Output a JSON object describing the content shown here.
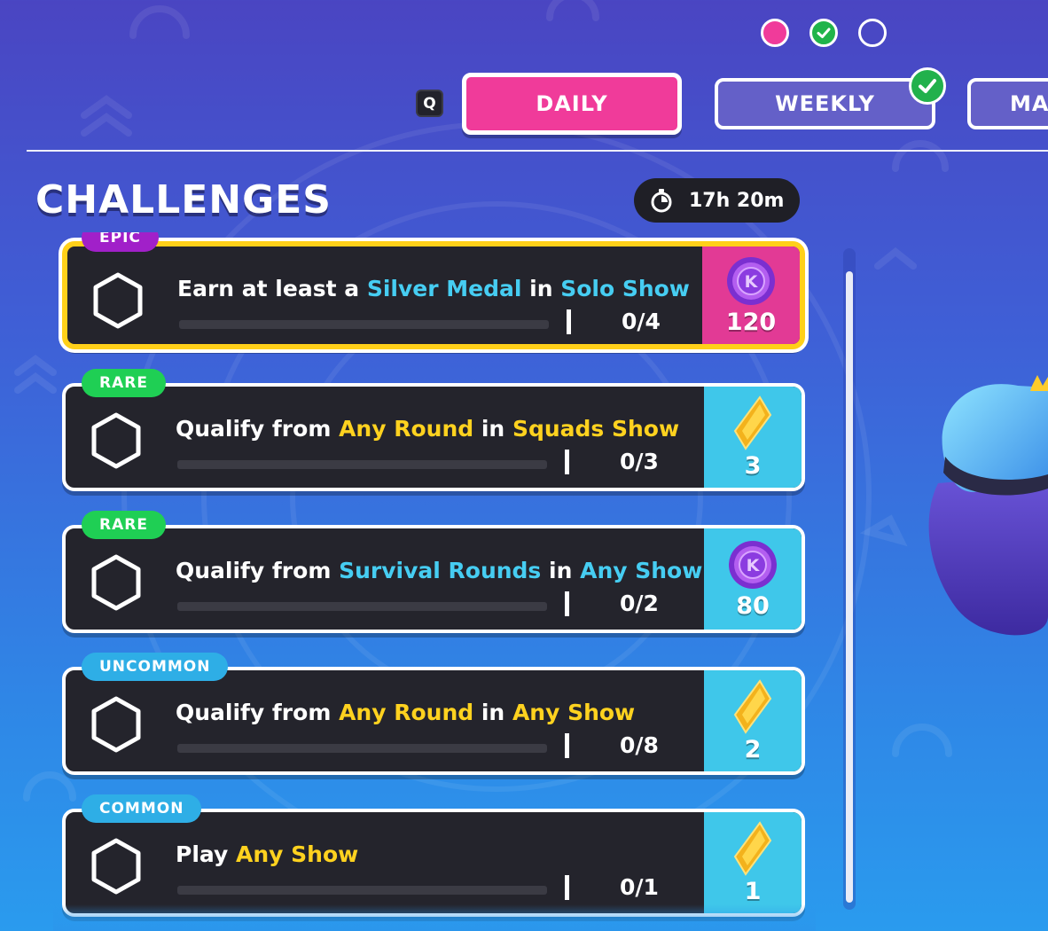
{
  "pager": {
    "pages": [
      {
        "state": "active"
      },
      {
        "state": "completed"
      },
      {
        "state": "empty"
      }
    ]
  },
  "tabs": {
    "key_hint": "Q",
    "items": [
      {
        "label": "DAILY",
        "selected": true
      },
      {
        "label": "WEEKLY",
        "completed": true
      },
      {
        "label": "MA"
      }
    ]
  },
  "header": {
    "title": "CHALLENGES",
    "timer": "17h 20m"
  },
  "challenges": [
    {
      "rarity": "EPIC",
      "parts": [
        {
          "text": "Earn at least a "
        },
        {
          "text": "Silver Medal",
          "hl": "cyan"
        },
        {
          "text": " in "
        },
        {
          "text": "Solo Show",
          "hl": "cyan"
        }
      ],
      "progress": "0/4",
      "progress_fraction": 0,
      "reward": "120",
      "reward_type": "kudos",
      "reward_bg": "#e23a95"
    },
    {
      "rarity": "RARE",
      "parts": [
        {
          "text": "Qualify from "
        },
        {
          "text": "Any Round",
          "hl": "yellow"
        },
        {
          "text": " in "
        },
        {
          "text": "Squads Show",
          "hl": "yellow"
        }
      ],
      "progress": "0/3",
      "progress_fraction": 0,
      "reward": "3",
      "reward_type": "gem",
      "reward_bg": "#3fc7ea"
    },
    {
      "rarity": "RARE",
      "parts": [
        {
          "text": "Qualify from "
        },
        {
          "text": "Survival Rounds",
          "hl": "cyan"
        },
        {
          "text": " in "
        },
        {
          "text": "Any Show",
          "hl": "cyan"
        }
      ],
      "progress": "0/2",
      "progress_fraction": 0,
      "reward": "80",
      "reward_type": "kudos",
      "reward_bg": "#3fc7ea"
    },
    {
      "rarity": "UNCOMMON",
      "parts": [
        {
          "text": "Qualify from "
        },
        {
          "text": "Any Round",
          "hl": "yellow"
        },
        {
          "text": " in "
        },
        {
          "text": "Any Show",
          "hl": "yellow"
        }
      ],
      "progress": "0/8",
      "progress_fraction": 0,
      "reward": "2",
      "reward_type": "gem",
      "reward_bg": "#3fc7ea"
    },
    {
      "rarity": "COMMON",
      "parts": [
        {
          "text": "Play "
        },
        {
          "text": "Any Show",
          "hl": "yellow"
        }
      ],
      "progress": "0/1",
      "progress_fraction": 0,
      "reward": "1",
      "reward_type": "gem",
      "reward_bg": "#3fc7ea"
    }
  ],
  "colors": {
    "accent_pink": "#f03b9a",
    "tab_inactive": "#6460c8",
    "epic": "#a120c9",
    "rare": "#1fcf54",
    "uncommon": "#2eaee6",
    "highlight_cyan": "#46cdf2",
    "highlight_yellow": "#ffd21f",
    "card_bg": "#24242c"
  }
}
